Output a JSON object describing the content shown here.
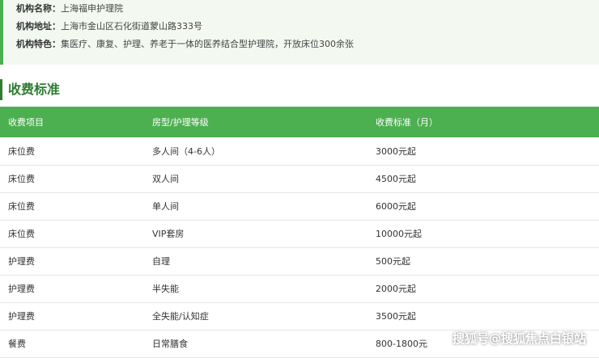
{
  "info": {
    "name_label": "机构名称：",
    "name_value": "上海福申护理院",
    "address_label": "机构地址：",
    "address_value": "上海市金山区石化街道蒙山路333号",
    "feature_label": "机构特色：",
    "feature_value": "集医疗、康复、护理、养老于一体的医养结合型护理院，开放床位300余张"
  },
  "section_title": "收费标准",
  "table": {
    "headers": [
      "收费项目",
      "房型/护理等级",
      "收费标准（月）"
    ],
    "rows": [
      [
        "床位费",
        "多人间（4-6人）",
        "3000元起"
      ],
      [
        "床位费",
        "双人间",
        "4500元起"
      ],
      [
        "床位费",
        "单人间",
        "6000元起"
      ],
      [
        "床位费",
        "VIP套房",
        "10000元起"
      ],
      [
        "护理费",
        "自理",
        "500元起"
      ],
      [
        "护理费",
        "半失能",
        "2000元起"
      ],
      [
        "护理费",
        "全失能/认知症",
        "3500元起"
      ],
      [
        "餐费",
        "日常膳食",
        "800-1800元"
      ]
    ]
  },
  "watermark": "搜狐号@搜狐焦点白银站",
  "colors": {
    "accent": "#4caf50",
    "title": "#2e7d32",
    "info_bg": "#f3f9f1"
  }
}
